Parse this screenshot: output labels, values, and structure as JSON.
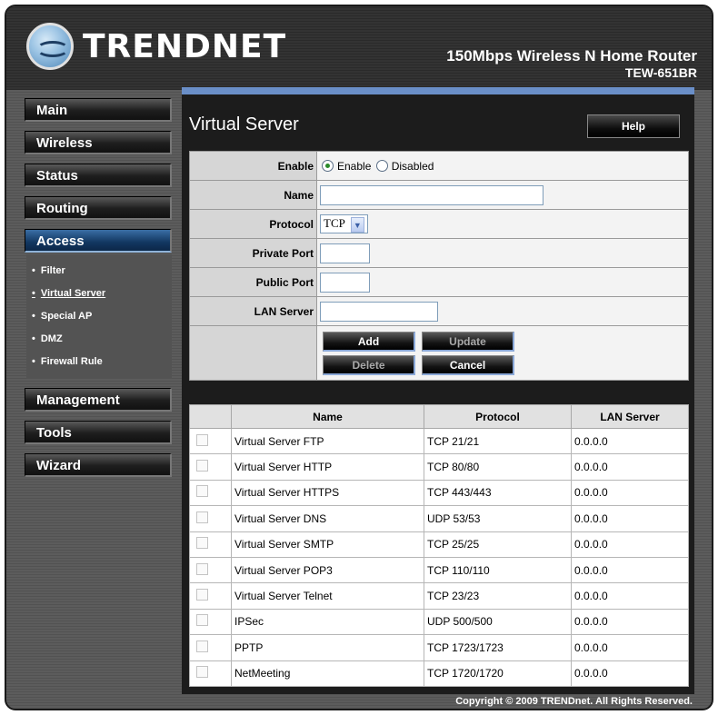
{
  "header": {
    "brand": "TRENDNET",
    "product_name": "150Mbps Wireless N Home Router",
    "model": "TEW-651BR"
  },
  "nav": {
    "items": [
      "Main",
      "Wireless",
      "Status",
      "Routing",
      "Access",
      "Management",
      "Tools",
      "Wizard"
    ],
    "active": "Access",
    "access_sub": [
      "Filter",
      "Virtual Server",
      "Special AP",
      "DMZ",
      "Firewall Rule"
    ],
    "current_sub": "Virtual Server"
  },
  "page": {
    "title": "Virtual Server",
    "help_label": "Help"
  },
  "form": {
    "enable_label": "Enable",
    "enable_option": "Enable",
    "disable_option": "Disabled",
    "name_label": "Name",
    "name_value": "",
    "protocol_label": "Protocol",
    "protocol_value": "TCP",
    "private_port_label": "Private Port",
    "private_port_value": "",
    "public_port_label": "Public Port",
    "public_port_value": "",
    "lan_server_label": "LAN Server",
    "lan_server_value": "",
    "buttons": {
      "add": "Add",
      "update": "Update",
      "delete": "Delete",
      "cancel": "Cancel"
    }
  },
  "table": {
    "headers": [
      "Name",
      "Protocol",
      "LAN Server"
    ],
    "rows": [
      {
        "name": "Virtual Server FTP",
        "protocol": "TCP 21/21",
        "lan": "0.0.0.0"
      },
      {
        "name": "Virtual Server HTTP",
        "protocol": "TCP 80/80",
        "lan": "0.0.0.0"
      },
      {
        "name": "Virtual Server HTTPS",
        "protocol": "TCP 443/443",
        "lan": "0.0.0.0"
      },
      {
        "name": "Virtual Server DNS",
        "protocol": "UDP 53/53",
        "lan": "0.0.0.0"
      },
      {
        "name": "Virtual Server SMTP",
        "protocol": "TCP 25/25",
        "lan": "0.0.0.0"
      },
      {
        "name": "Virtual Server POP3",
        "protocol": "TCP 110/110",
        "lan": "0.0.0.0"
      },
      {
        "name": "Virtual Server Telnet",
        "protocol": "TCP 23/23",
        "lan": "0.0.0.0"
      },
      {
        "name": "IPSec",
        "protocol": "UDP 500/500",
        "lan": "0.0.0.0"
      },
      {
        "name": "PPTP",
        "protocol": "TCP 1723/1723",
        "lan": "0.0.0.0"
      },
      {
        "name": "NetMeeting",
        "protocol": "TCP 1720/1720",
        "lan": "0.0.0.0"
      }
    ]
  },
  "footer": {
    "copyright": "Copyright © 2009 TRENDnet. All Rights Reserved."
  }
}
